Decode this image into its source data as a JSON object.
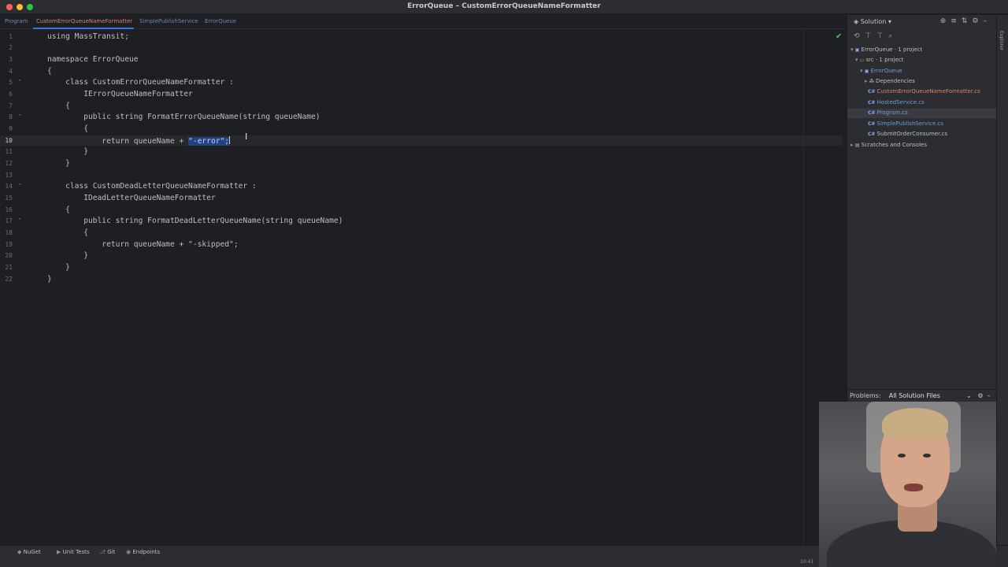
{
  "window": {
    "title": "ErrorQueue – CustomErrorQueueNameFormatter"
  },
  "tabs": [
    {
      "label": "Program"
    },
    {
      "label": "CustomErrorQueueNameFormatter",
      "active": true
    },
    {
      "label": "SimplePublishService"
    },
    {
      "label": "ErrorQueue"
    }
  ],
  "editor": {
    "current_line": 10,
    "line_numbers": [
      "1",
      "2",
      "3",
      "4",
      "5",
      "6",
      "7",
      "8",
      "9",
      "10",
      "11",
      "12",
      "13",
      "14",
      "15",
      "16",
      "17",
      "18",
      "19",
      "20",
      "21",
      "22"
    ],
    "lines": {
      "l1": "using MassTransit;",
      "l3": "namespace ErrorQueue",
      "l4": "{",
      "l5": "    class CustomErrorQueueNameFormatter :",
      "l6": "        IErrorQueueNameFormatter",
      "l7": "    {",
      "l8": "        public string FormatErrorQueueName(string queueName)",
      "l9": "        {",
      "l10_pre": "            return queueName + ",
      "l10_sel": "\"-error\";",
      "l11": "        }",
      "l12": "    }",
      "l14": "    class CustomDeadLetterQueueNameFormatter :",
      "l15": "        IDeadLetterQueueNameFormatter",
      "l16": "    {",
      "l17": "        public string FormatDeadLetterQueueName(string queueName)",
      "l18": "        {",
      "l19": "            return queueName + \"-skipped\";",
      "l20": "        }",
      "l21": "    }",
      "l22": "}"
    }
  },
  "solution": {
    "header": "Solution",
    "items": [
      {
        "label": "ErrorQueue · 1 project",
        "icon": "solution-icon"
      },
      {
        "label": "src · 1 project",
        "icon": "folder-icon"
      },
      {
        "label": "ErrorQueue",
        "icon": "project-icon"
      },
      {
        "label": "Dependencies",
        "icon": "dependencies-icon"
      },
      {
        "label": "CustomErrorQueueNameFormatter.cs",
        "icon": "csharp-file-icon",
        "modified": true
      },
      {
        "label": "HostedService.cs",
        "icon": "csharp-file-icon"
      },
      {
        "label": "Program.cs",
        "icon": "csharp-file-icon",
        "selected": true
      },
      {
        "label": "SimplePublishService.cs",
        "icon": "csharp-file-icon"
      },
      {
        "label": "SubmitOrderConsumer.cs",
        "icon": "csharp-file-icon"
      },
      {
        "label": "Scratches and Consoles",
        "icon": "scratches-icon"
      }
    ]
  },
  "problems": {
    "title": "Problems:",
    "scope": "All Solution Files"
  },
  "explorer_label": "Explorer",
  "statusbar": {
    "nuget": "NuGet",
    "unit_tests": "Unit Tests",
    "git": "Git",
    "endpoints": "Endpoints",
    "clock": "10:41"
  },
  "colors": {
    "accent": "#3574f0",
    "keyword": "#cf8e6d",
    "type": "#c191ff",
    "method": "#56a8f5",
    "string": "#6aab73"
  }
}
